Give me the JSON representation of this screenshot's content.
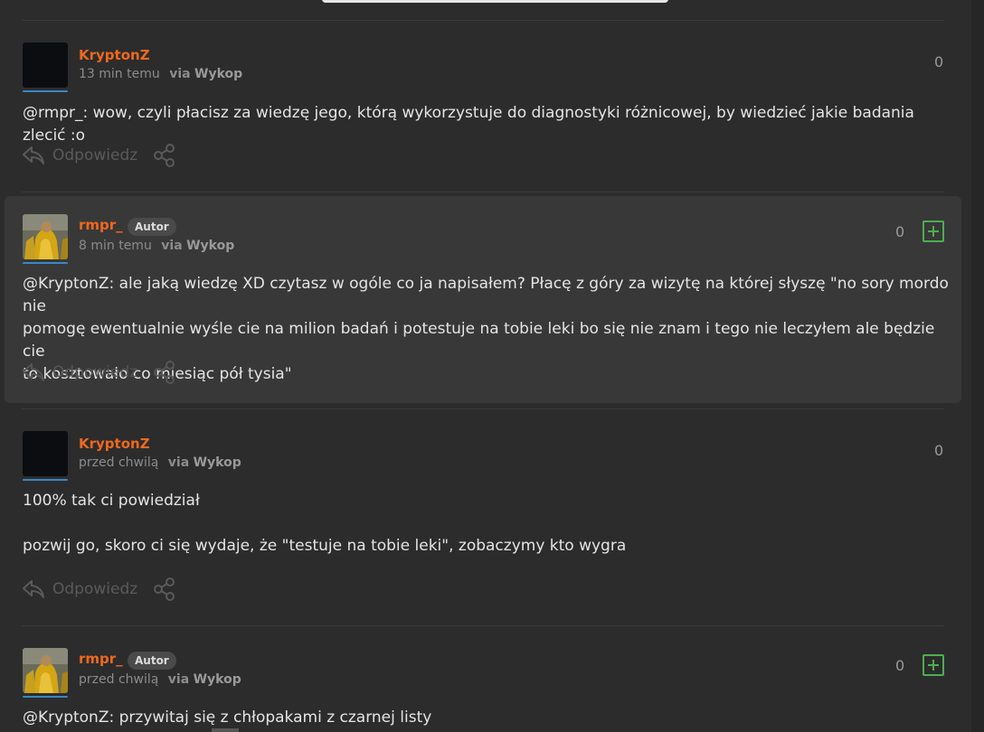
{
  "comments": [
    {
      "author": "KryptonZ",
      "time": "13 min temu",
      "via_prefix": "via",
      "via": "Wykop",
      "score": "0",
      "mention": "@rmpr_",
      "text": ": wow, czyli płacisz za wiedzę jego, którą wykorzystuje do diagnostyki różnicowej, by wiedzieć jakie badania zlecić :o",
      "reply_label": "Odpowiedz"
    },
    {
      "author": "rmpr_",
      "badge": "Autor",
      "time": "8 min temu",
      "via_prefix": "via",
      "via": "Wykop",
      "score": "0",
      "mention": "@KryptonZ",
      "text_line1": ": ale jaką wiedzę XD czytasz w ogóle co ja napisałem? Płacę z góry za wizytę na której słyszę \"no sory mordo nie",
      "text_line2": "pomogę ewentualnie wyśle cie na milion badań i potestuje na tobie leki bo się nie znam i tego nie leczyłem ale będzie cie",
      "text_line3": "to kosztowało co miesiąc pół tysia\"",
      "reply_label": "Odpowiedz"
    },
    {
      "author": "KryptonZ",
      "time": "przed chwilą",
      "via_prefix": "via",
      "via": "Wykop",
      "score": "0",
      "para1": "100% tak ci powiedział",
      "para2": "pozwij go, skoro ci się wydaje, że \"testuje na tobie leki\", zobaczymy kto wygra",
      "reply_label": "Odpowiedz"
    },
    {
      "author": "rmpr_",
      "badge": "Autor",
      "time": "przed chwilą",
      "via_prefix": "via",
      "via": "Wykop",
      "score": "0",
      "mention": "@KryptonZ",
      "text": ": przywitaj się z chłopakami z czarnej listy"
    }
  ],
  "colors": {
    "background": "#2c2c2c",
    "highlight": "#383838",
    "author": "#f0681e",
    "plus": "#4caf50",
    "avatar_line": "#3b87c5"
  },
  "icons": {
    "reply": "reply-arrow-icon",
    "share": "share-icon",
    "plus": "plus-square-icon"
  }
}
